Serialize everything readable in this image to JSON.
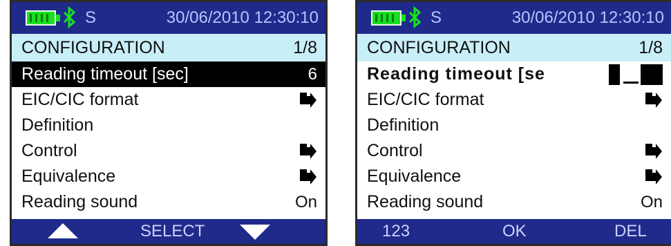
{
  "status": {
    "letter": "S",
    "datetime": "30/06/2010  12:30:10",
    "battery_color": "#17e01f"
  },
  "left": {
    "header": {
      "title": "CONFIGURATION",
      "page": "1/8"
    },
    "items": [
      {
        "label": "Reading timeout [sec]",
        "value": "6"
      },
      {
        "label": "EIC/CIC format",
        "icon": "arrow-right-icon"
      },
      {
        "label": "Definition"
      },
      {
        "label": "Control",
        "icon": "arrow-right-icon"
      },
      {
        "label": "Equivalence",
        "icon": "arrow-right-icon"
      },
      {
        "label": "Reading sound",
        "value": "On"
      }
    ],
    "softkeys": {
      "left": "up-triangle-icon",
      "center": "SELECT",
      "right": "down-triangle-icon"
    }
  },
  "right": {
    "header": {
      "title": "CONFIGURATION",
      "page": "1/8"
    },
    "items": [
      {
        "label": "Reading timeout [se",
        "edit": "cursor"
      },
      {
        "label": "EIC/CIC format",
        "icon": "arrow-right-icon"
      },
      {
        "label": "Definition"
      },
      {
        "label": "Control",
        "icon": "arrow-right-icon"
      },
      {
        "label": "Equivalence",
        "icon": "arrow-right-icon"
      },
      {
        "label": "Reading sound",
        "value": "On"
      }
    ],
    "softkeys": {
      "left": "123",
      "center": "OK",
      "right": "DEL"
    }
  },
  "colors": {
    "bar": "#1f2a8a",
    "header": "#c8eef8",
    "selected": "#000000"
  }
}
